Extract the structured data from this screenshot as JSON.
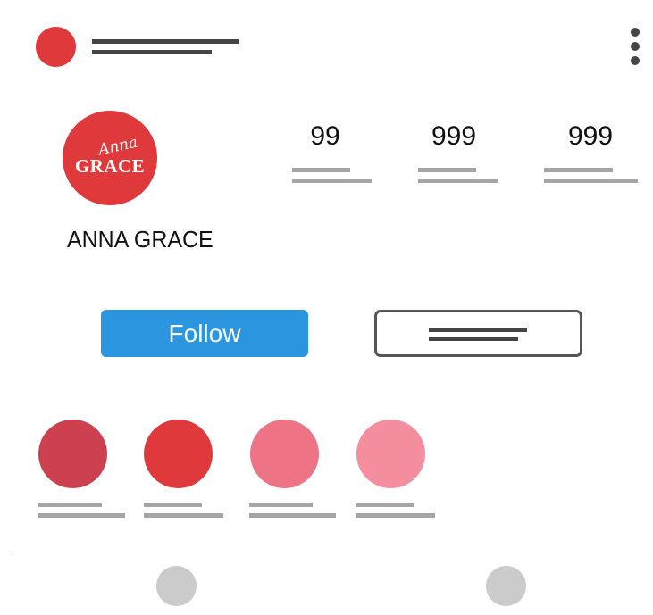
{
  "profile": {
    "name": "ANNA GRACE",
    "logo_script": "Anna",
    "logo_block": "GRACE",
    "accent_color": "#e0393c"
  },
  "stats": [
    {
      "value": "99"
    },
    {
      "value": "999"
    },
    {
      "value": "999"
    }
  ],
  "actions": {
    "follow_label": "Follow",
    "follow_color": "#2b95e0"
  },
  "highlights": [
    {
      "color": "#cc4050"
    },
    {
      "color": "#e0393c"
    },
    {
      "color": "#ee7384"
    },
    {
      "color": "#f48e9f"
    }
  ],
  "icons": {
    "menu": "more-vertical-icon"
  }
}
